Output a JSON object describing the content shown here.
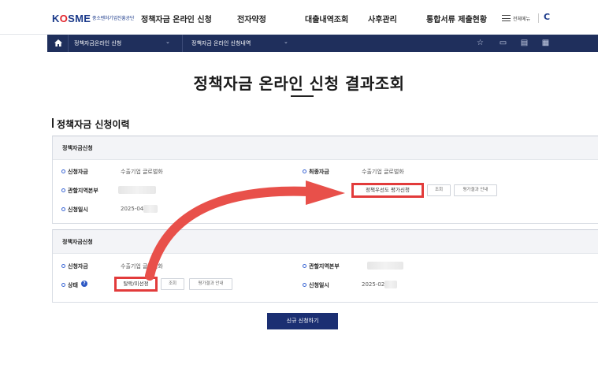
{
  "header": {
    "logo_text": "KOSME",
    "logo_sub": "중소벤처기업진흥공단",
    "menu": [
      "정책자금 온라인 신청",
      "전자약정",
      "대출내역조회",
      "사후관리",
      "통합서류 제출현황"
    ],
    "all_menu_label": "전체메뉴"
  },
  "breadcrumb": {
    "items": [
      "정책자금온라인 신청",
      "정책자금 온라인 신청내역"
    ]
  },
  "page": {
    "title": "정책자금 온라인 신청 결과조회",
    "section_title": "정책자금 신청이력"
  },
  "panel1": {
    "heading": "정책자금신청",
    "fields": {
      "apply_fund_label": "신청자금",
      "apply_fund_value": "수출기업 글로벌화",
      "final_fund_label": "최종자금",
      "final_fund_value": "수출기업 글로벌화",
      "region_label": "관할지역본부",
      "date_label": "신청일시",
      "date_value": "2025-04"
    },
    "buttons": {
      "priority_eval": "정책우선도 평가신청",
      "lookup": "조회",
      "eval_guide": "평가결과 안내"
    }
  },
  "panel2": {
    "heading": "정책자금신청",
    "fields": {
      "apply_fund_label": "신청자금",
      "apply_fund_value": "수출기업 글로벌화",
      "region_label": "관할지역본부",
      "status_label": "상태",
      "date_label": "신청일시",
      "date_value": "2025-02"
    },
    "buttons": {
      "status_result": "탈락/미선정",
      "lookup": "조회",
      "eval_guide": "평가결과 안내"
    }
  },
  "actions": {
    "new_apply": "신규 신청하기"
  },
  "colors": {
    "brand": "#1b3a8a",
    "nav_bar": "#1f2f5c",
    "highlight": "#e23b3b",
    "submit": "#1b2f72"
  }
}
